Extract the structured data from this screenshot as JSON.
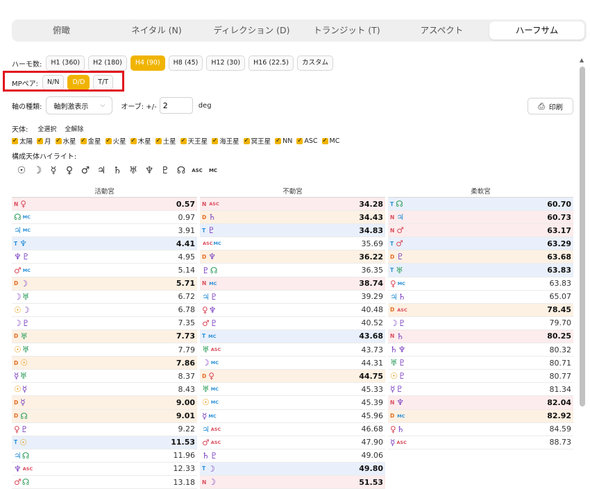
{
  "tabs": [
    "俯瞰",
    "ネイタル (N)",
    "ディレクション (D)",
    "トランジット (T)",
    "アスペクト",
    "ハーフサム"
  ],
  "active_tab": 5,
  "harmonic": {
    "label": "ハーモ数:",
    "options": [
      "H1 (360)",
      "H2 (180)",
      "H4 (90)",
      "H8 (45)",
      "H12 (30)",
      "H16 (22.5)",
      "カスタム"
    ],
    "active": 2
  },
  "mp": {
    "label": "MPペア:",
    "options": [
      "N/N",
      "D/D",
      "T/T"
    ],
    "active": 1
  },
  "axis": {
    "label": "軸の種類:",
    "value": "軸刺激表示",
    "orb_label": "オーブ: +/-",
    "orb_value": "2",
    "orb_unit": "deg"
  },
  "print_label": "印刷",
  "planets": {
    "label": "天体:",
    "select_all": "全選択",
    "clear_all": "全解除",
    "items": [
      "太陽",
      "月",
      "水星",
      "金星",
      "火星",
      "木星",
      "土星",
      "天王星",
      "海王星",
      "冥王星",
      "NN",
      "ASC",
      "MC"
    ]
  },
  "highlight": {
    "label": "構成天体ハイライト:",
    "items": [
      "☉",
      "☽",
      "☿",
      "♀",
      "♂",
      "♃",
      "♄",
      "♅",
      "♆",
      "♇",
      "☊",
      "ASC",
      "MC"
    ]
  },
  "columns": [
    {
      "title": "活動宮",
      "rows": [
        {
          "p": "N",
          "s": [
            "♀"
          ],
          "c": [
            "s1"
          ],
          "v": "0.57",
          "b": 1,
          "bg": "red"
        },
        {
          "p": "",
          "s": [
            "☊",
            "MC"
          ],
          "c": [
            "s6",
            "s2"
          ],
          "v": "0.97",
          "b": 0,
          "bg": ""
        },
        {
          "p": "",
          "s": [
            "♃",
            "MC"
          ],
          "c": [
            "s2",
            "s2"
          ],
          "v": "3.91",
          "b": 0,
          "bg": ""
        },
        {
          "p": "T",
          "s": [
            "♆"
          ],
          "c": [
            "s2"
          ],
          "v": "4.41",
          "b": 1,
          "bg": "blue"
        },
        {
          "p": "",
          "s": [
            "♆",
            "♇"
          ],
          "c": [
            "s4",
            "s4"
          ],
          "v": "4.95",
          "b": 0,
          "bg": ""
        },
        {
          "p": "",
          "s": [
            "♂",
            "MC"
          ],
          "c": [
            "s1",
            "s2"
          ],
          "v": "5.14",
          "b": 0,
          "bg": ""
        },
        {
          "p": "D",
          "s": [
            "☽"
          ],
          "c": [
            "s4"
          ],
          "v": "5.71",
          "b": 1,
          "bg": "orange"
        },
        {
          "p": "",
          "s": [
            "☽",
            "♅"
          ],
          "c": [
            "s4",
            "s6"
          ],
          "v": "6.72",
          "b": 0,
          "bg": ""
        },
        {
          "p": "",
          "s": [
            "☉",
            "☽"
          ],
          "c": [
            "s5",
            "s4"
          ],
          "v": "6.78",
          "b": 0,
          "bg": ""
        },
        {
          "p": "",
          "s": [
            "☽",
            "♇"
          ],
          "c": [
            "s4",
            "s4"
          ],
          "v": "7.35",
          "b": 0,
          "bg": ""
        },
        {
          "p": "D",
          "s": [
            "♅"
          ],
          "c": [
            "s6"
          ],
          "v": "7.73",
          "b": 1,
          "bg": "orange"
        },
        {
          "p": "",
          "s": [
            "☉",
            "♅"
          ],
          "c": [
            "s5",
            "s6"
          ],
          "v": "7.79",
          "b": 0,
          "bg": ""
        },
        {
          "p": "D",
          "s": [
            "☉"
          ],
          "c": [
            "s5"
          ],
          "v": "7.86",
          "b": 1,
          "bg": "orange"
        },
        {
          "p": "",
          "s": [
            "☿",
            "♅"
          ],
          "c": [
            "s4",
            "s6"
          ],
          "v": "8.37",
          "b": 0,
          "bg": ""
        },
        {
          "p": "",
          "s": [
            "☉",
            "☿"
          ],
          "c": [
            "s5",
            "s4"
          ],
          "v": "8.43",
          "b": 0,
          "bg": ""
        },
        {
          "p": "D",
          "s": [
            "☿"
          ],
          "c": [
            "s4"
          ],
          "v": "9.00",
          "b": 1,
          "bg": "orange"
        },
        {
          "p": "D",
          "s": [
            "☊"
          ],
          "c": [
            "s6"
          ],
          "v": "9.01",
          "b": 1,
          "bg": "orange"
        },
        {
          "p": "",
          "s": [
            "♀",
            "♇"
          ],
          "c": [
            "s1",
            "s4"
          ],
          "v": "9.22",
          "b": 0,
          "bg": ""
        },
        {
          "p": "T",
          "s": [
            "☉"
          ],
          "c": [
            "s5"
          ],
          "v": "11.53",
          "b": 1,
          "bg": "blue"
        },
        {
          "p": "",
          "s": [
            "♃",
            "☊"
          ],
          "c": [
            "s2",
            "s6"
          ],
          "v": "11.96",
          "b": 0,
          "bg": ""
        },
        {
          "p": "",
          "s": [
            "♆",
            "ASC"
          ],
          "c": [
            "s4",
            "s1"
          ],
          "v": "12.33",
          "b": 0,
          "bg": ""
        },
        {
          "p": "",
          "s": [
            "♂",
            "☊"
          ],
          "c": [
            "s1",
            "s6"
          ],
          "v": "13.18",
          "b": 0,
          "bg": ""
        }
      ]
    },
    {
      "title": "不動宮",
      "rows": [
        {
          "p": "N",
          "s": [
            "ASC"
          ],
          "c": [
            "s1"
          ],
          "v": "34.28",
          "b": 1,
          "bg": "red"
        },
        {
          "p": "D",
          "s": [
            "♄"
          ],
          "c": [
            "s4"
          ],
          "v": "34.43",
          "b": 1,
          "bg": "orange"
        },
        {
          "p": "T",
          "s": [
            "♇"
          ],
          "c": [
            "s4"
          ],
          "v": "34.83",
          "b": 1,
          "bg": "blue"
        },
        {
          "p": "",
          "s": [
            "ASC",
            "MC"
          ],
          "c": [
            "s1",
            "s2"
          ],
          "v": "35.69",
          "b": 0,
          "bg": ""
        },
        {
          "p": "D",
          "s": [
            "♆"
          ],
          "c": [
            "s4"
          ],
          "v": "36.22",
          "b": 1,
          "bg": "orange"
        },
        {
          "p": "",
          "s": [
            "♇",
            "☊"
          ],
          "c": [
            "s4",
            "s6"
          ],
          "v": "36.35",
          "b": 0,
          "bg": ""
        },
        {
          "p": "N",
          "s": [
            "MC"
          ],
          "c": [
            "s2"
          ],
          "v": "38.74",
          "b": 1,
          "bg": "red"
        },
        {
          "p": "",
          "s": [
            "♃",
            "♇"
          ],
          "c": [
            "s2",
            "s4"
          ],
          "v": "39.29",
          "b": 0,
          "bg": ""
        },
        {
          "p": "",
          "s": [
            "♀",
            "♆"
          ],
          "c": [
            "s1",
            "s4"
          ],
          "v": "40.48",
          "b": 0,
          "bg": ""
        },
        {
          "p": "",
          "s": [
            "♂",
            "♇"
          ],
          "c": [
            "s1",
            "s4"
          ],
          "v": "40.52",
          "b": 0,
          "bg": ""
        },
        {
          "p": "T",
          "s": [
            "MC"
          ],
          "c": [
            "s2"
          ],
          "v": "43.68",
          "b": 1,
          "bg": "blue"
        },
        {
          "p": "",
          "s": [
            "♅",
            "ASC"
          ],
          "c": [
            "s6",
            "s1"
          ],
          "v": "43.73",
          "b": 0,
          "bg": ""
        },
        {
          "p": "",
          "s": [
            "☽",
            "MC"
          ],
          "c": [
            "s4",
            "s2"
          ],
          "v": "44.31",
          "b": 0,
          "bg": ""
        },
        {
          "p": "D",
          "s": [
            "♀"
          ],
          "c": [
            "s1"
          ],
          "v": "44.75",
          "b": 1,
          "bg": "orange"
        },
        {
          "p": "",
          "s": [
            "♅",
            "MC"
          ],
          "c": [
            "s6",
            "s2"
          ],
          "v": "45.33",
          "b": 0,
          "bg": ""
        },
        {
          "p": "",
          "s": [
            "☉",
            "MC"
          ],
          "c": [
            "s5",
            "s2"
          ],
          "v": "45.39",
          "b": 0,
          "bg": ""
        },
        {
          "p": "",
          "s": [
            "☿",
            "MC"
          ],
          "c": [
            "s4",
            "s2"
          ],
          "v": "45.96",
          "b": 0,
          "bg": ""
        },
        {
          "p": "",
          "s": [
            "♃",
            "ASC"
          ],
          "c": [
            "s2",
            "s1"
          ],
          "v": "46.68",
          "b": 0,
          "bg": ""
        },
        {
          "p": "",
          "s": [
            "♂",
            "ASC"
          ],
          "c": [
            "s1",
            "s1"
          ],
          "v": "47.90",
          "b": 0,
          "bg": ""
        },
        {
          "p": "",
          "s": [
            "♄",
            "♇"
          ],
          "c": [
            "s4",
            "s4"
          ],
          "v": "49.06",
          "b": 0,
          "bg": ""
        },
        {
          "p": "T",
          "s": [
            "☽"
          ],
          "c": [
            "s4"
          ],
          "v": "49.80",
          "b": 1,
          "bg": "blue"
        },
        {
          "p": "N",
          "s": [
            "☽"
          ],
          "c": [
            "s4"
          ],
          "v": "51.53",
          "b": 1,
          "bg": "red"
        }
      ]
    },
    {
      "title": "柔軟宮",
      "rows": [
        {
          "p": "T",
          "s": [
            "☊"
          ],
          "c": [
            "s6"
          ],
          "v": "60.70",
          "b": 1,
          "bg": "blue"
        },
        {
          "p": "N",
          "s": [
            "♃"
          ],
          "c": [
            "s2"
          ],
          "v": "60.73",
          "b": 1,
          "bg": "red"
        },
        {
          "p": "N",
          "s": [
            "♂"
          ],
          "c": [
            "s1"
          ],
          "v": "63.17",
          "b": 1,
          "bg": "red"
        },
        {
          "p": "T",
          "s": [
            "♂"
          ],
          "c": [
            "s1"
          ],
          "v": "63.29",
          "b": 1,
          "bg": "blue"
        },
        {
          "p": "D",
          "s": [
            "♇"
          ],
          "c": [
            "s4"
          ],
          "v": "63.68",
          "b": 1,
          "bg": "orange"
        },
        {
          "p": "T",
          "s": [
            "♅"
          ],
          "c": [
            "s6"
          ],
          "v": "63.83",
          "b": 1,
          "bg": "blue"
        },
        {
          "p": "",
          "s": [
            "♀",
            "MC"
          ],
          "c": [
            "s1",
            "s2"
          ],
          "v": "63.83",
          "b": 0,
          "bg": ""
        },
        {
          "p": "",
          "s": [
            "♃",
            "♄"
          ],
          "c": [
            "s2",
            "s4"
          ],
          "v": "65.07",
          "b": 0,
          "bg": ""
        },
        {
          "p": "D",
          "s": [
            "ASC"
          ],
          "c": [
            "s1"
          ],
          "v": "78.45",
          "b": 1,
          "bg": "orange"
        },
        {
          "p": "",
          "s": [
            "☽",
            "♇"
          ],
          "c": [
            "s4",
            "s4"
          ],
          "v": "79.70",
          "b": 0,
          "bg": ""
        },
        {
          "p": "N",
          "s": [
            "♄"
          ],
          "c": [
            "s4"
          ],
          "v": "80.25",
          "b": 1,
          "bg": "red"
        },
        {
          "p": "",
          "s": [
            "♄",
            "♆"
          ],
          "c": [
            "s4",
            "s4"
          ],
          "v": "80.32",
          "b": 0,
          "bg": ""
        },
        {
          "p": "",
          "s": [
            "♅",
            "♇"
          ],
          "c": [
            "s6",
            "s4"
          ],
          "v": "80.71",
          "b": 0,
          "bg": ""
        },
        {
          "p": "",
          "s": [
            "☉",
            "♇"
          ],
          "c": [
            "s5",
            "s4"
          ],
          "v": "80.77",
          "b": 0,
          "bg": ""
        },
        {
          "p": "",
          "s": [
            "☿",
            "♇"
          ],
          "c": [
            "s4",
            "s4"
          ],
          "v": "81.34",
          "b": 0,
          "bg": ""
        },
        {
          "p": "N",
          "s": [
            "♆"
          ],
          "c": [
            "s4"
          ],
          "v": "82.04",
          "b": 1,
          "bg": "red"
        },
        {
          "p": "D",
          "s": [
            "MC"
          ],
          "c": [
            "s2"
          ],
          "v": "82.92",
          "b": 1,
          "bg": "orange"
        },
        {
          "p": "",
          "s": [
            "♀",
            "♄"
          ],
          "c": [
            "s1",
            "s4"
          ],
          "v": "84.59",
          "b": 0,
          "bg": ""
        },
        {
          "p": "",
          "s": [
            "☿",
            "ASC"
          ],
          "c": [
            "s4",
            "s1"
          ],
          "v": "88.73",
          "b": 0,
          "bg": ""
        }
      ]
    }
  ]
}
